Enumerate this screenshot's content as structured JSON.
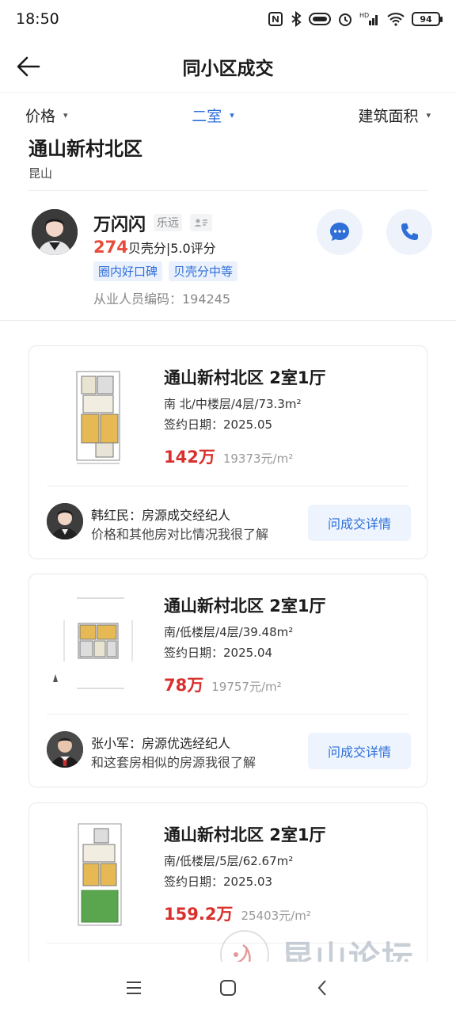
{
  "status_bar": {
    "time": "18:50",
    "battery": "94"
  },
  "header": {
    "title": "同小区成交"
  },
  "filters": [
    {
      "label": "价格",
      "active": false
    },
    {
      "label": "二室",
      "active": true
    },
    {
      "label": "建筑面积",
      "active": false
    }
  ],
  "community": {
    "name": "通山新村北区",
    "city": "昆山"
  },
  "agent": {
    "name": "万闪闪",
    "company": "乐远",
    "score": "274",
    "score_suffix": "贝壳分|5.0评分",
    "tags": [
      "圈内好口碑",
      "贝壳分中等"
    ],
    "code": "从业人员编码：194245"
  },
  "listings": [
    {
      "title": "通山新村北区 2室1厅",
      "spec": "南 北/中楼层/4层/73.3m²",
      "date": "签约日期：2025.05",
      "price": "142万",
      "unit_price": "19373元/m²",
      "agent_name": "韩红民：房源成交经纪人",
      "agent_desc": "价格和其他房对比情况我很了解",
      "button": "问成交详情"
    },
    {
      "title": "通山新村北区 2室1厅",
      "spec": "南/低楼层/4层/39.48m²",
      "date": "签约日期：2025.04",
      "price": "78万",
      "unit_price": "19757元/m²",
      "agent_name": "张小军：房源优选经纪人",
      "agent_desc": "和这套房相似的房源我很了解",
      "button": "问成交详情"
    },
    {
      "title": "通山新村北区 2室1厅",
      "spec": "南/低楼层/5层/62.67m²",
      "date": "签约日期：2025.03",
      "price": "159.2万",
      "unit_price": "25403元/m²"
    }
  ],
  "watermark": {
    "text": "昆山论坛"
  },
  "colors": {
    "accent": "#2e6fd8",
    "price": "#d9302c",
    "score": "#e64b3c"
  }
}
